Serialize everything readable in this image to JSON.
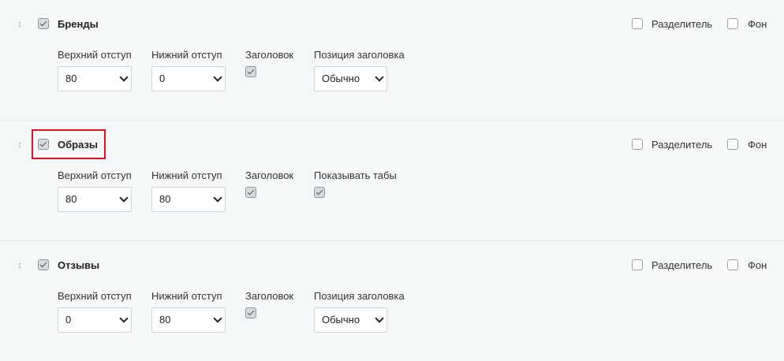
{
  "labels": {
    "top_margin": "Верхний отступ",
    "bottom_margin": "Нижний отступ",
    "heading": "Заголовок",
    "heading_position": "Позиция заголовка",
    "show_tabs": "Показывать табы",
    "separator": "Разделитель",
    "background": "Фон"
  },
  "blocks": [
    {
      "title": "Бренды",
      "enabled": true,
      "separator": false,
      "background": false,
      "top_margin": "80",
      "bottom_margin": "0",
      "heading": true,
      "heading_position": "Обычно"
    },
    {
      "title": "Образы",
      "enabled": true,
      "highlighted": true,
      "separator": false,
      "background": false,
      "top_margin": "80",
      "bottom_margin": "80",
      "heading": true,
      "show_tabs": true
    },
    {
      "title": "Отзывы",
      "enabled": true,
      "separator": false,
      "background": false,
      "top_margin": "0",
      "bottom_margin": "80",
      "heading": true,
      "heading_position": "Обычно"
    }
  ],
  "icons": {
    "drag_handle": "drag-handle-icon",
    "dropdown_arrow": "chevron-down-icon"
  },
  "colors": {
    "background": "#f5f8f9",
    "highlight": "#e0141e",
    "divider": "#e0e5e7"
  }
}
